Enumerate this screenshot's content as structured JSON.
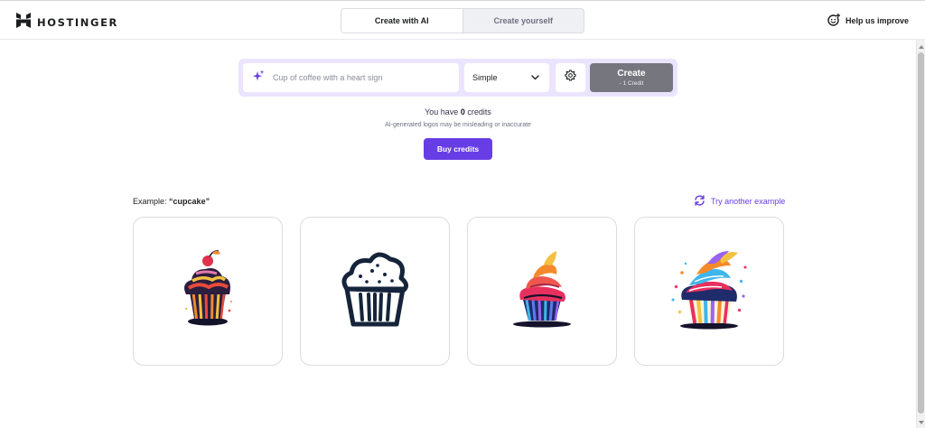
{
  "header": {
    "brand": "HOSTINGER",
    "mode_tabs": [
      {
        "label": "Create with AI",
        "active": true
      },
      {
        "label": "Create yourself",
        "active": false
      }
    ],
    "help_label": "Help us improve"
  },
  "prompt": {
    "placeholder": "Cup of coffee with a heart sign",
    "value": "",
    "style_value": "Simple",
    "create_label": "Create",
    "create_cost": "- 1 Credit"
  },
  "credits": {
    "prefix": "You have",
    "count": "0",
    "suffix": "credits",
    "disclaimer": "AI-generated logos may be misleading or inaccurate",
    "buy_label": "Buy credits"
  },
  "examples": {
    "label_prefix": "Example:",
    "keyword": "“cupcake”",
    "try_another_label": "Try another example",
    "cards": [
      {
        "icon": "cupcake-cherry-logo-icon"
      },
      {
        "icon": "cupcake-outline-logo-icon"
      },
      {
        "icon": "cupcake-swirl-logo-icon"
      },
      {
        "icon": "cupcake-colorful-logo-icon"
      }
    ]
  },
  "colors": {
    "accent": "#673de6",
    "prompt_bg": "#ebe4ff",
    "create_disabled": "#76767f",
    "text": "#1d1e20"
  }
}
